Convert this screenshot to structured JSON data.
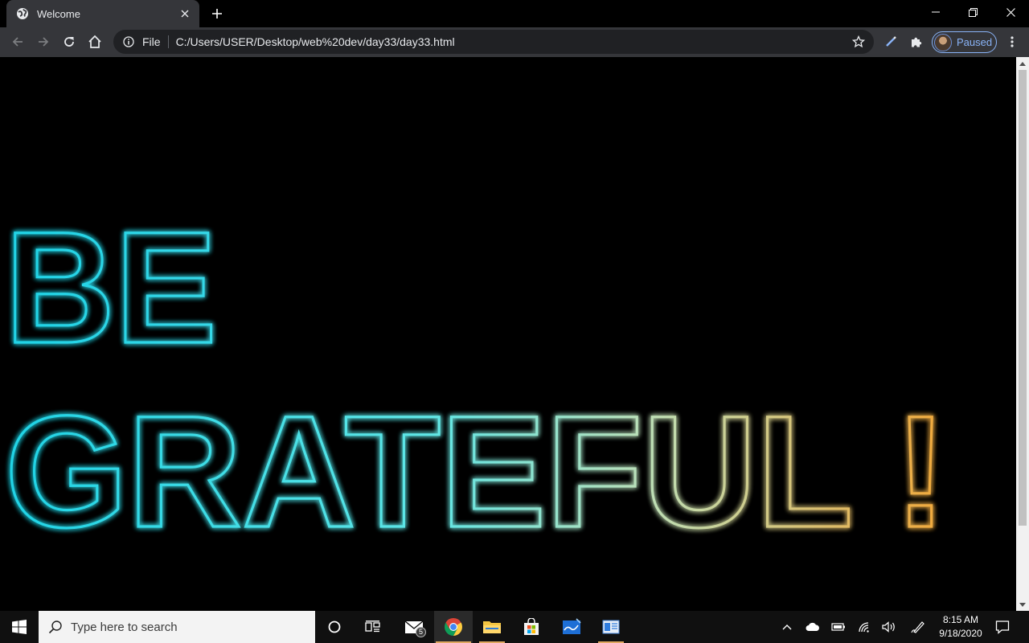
{
  "browser": {
    "tab": {
      "title": "Welcome",
      "favicon": "globe-icon"
    },
    "omnibox": {
      "scheme": "File",
      "url": "C:/Users/USER/Desktop/web%20dev/day33/day33.html"
    },
    "profile": {
      "label": "Paused"
    }
  },
  "page": {
    "line1": "BE",
    "line2": "GRATEFUL !",
    "colors": {
      "start": "#1fd3e6",
      "end": "#f2a83a",
      "glow": "#ffffff"
    }
  },
  "taskbar": {
    "search_placeholder": "Type here to search",
    "mail_badge": "5",
    "time": "8:15 AM",
    "date": "9/18/2020"
  }
}
